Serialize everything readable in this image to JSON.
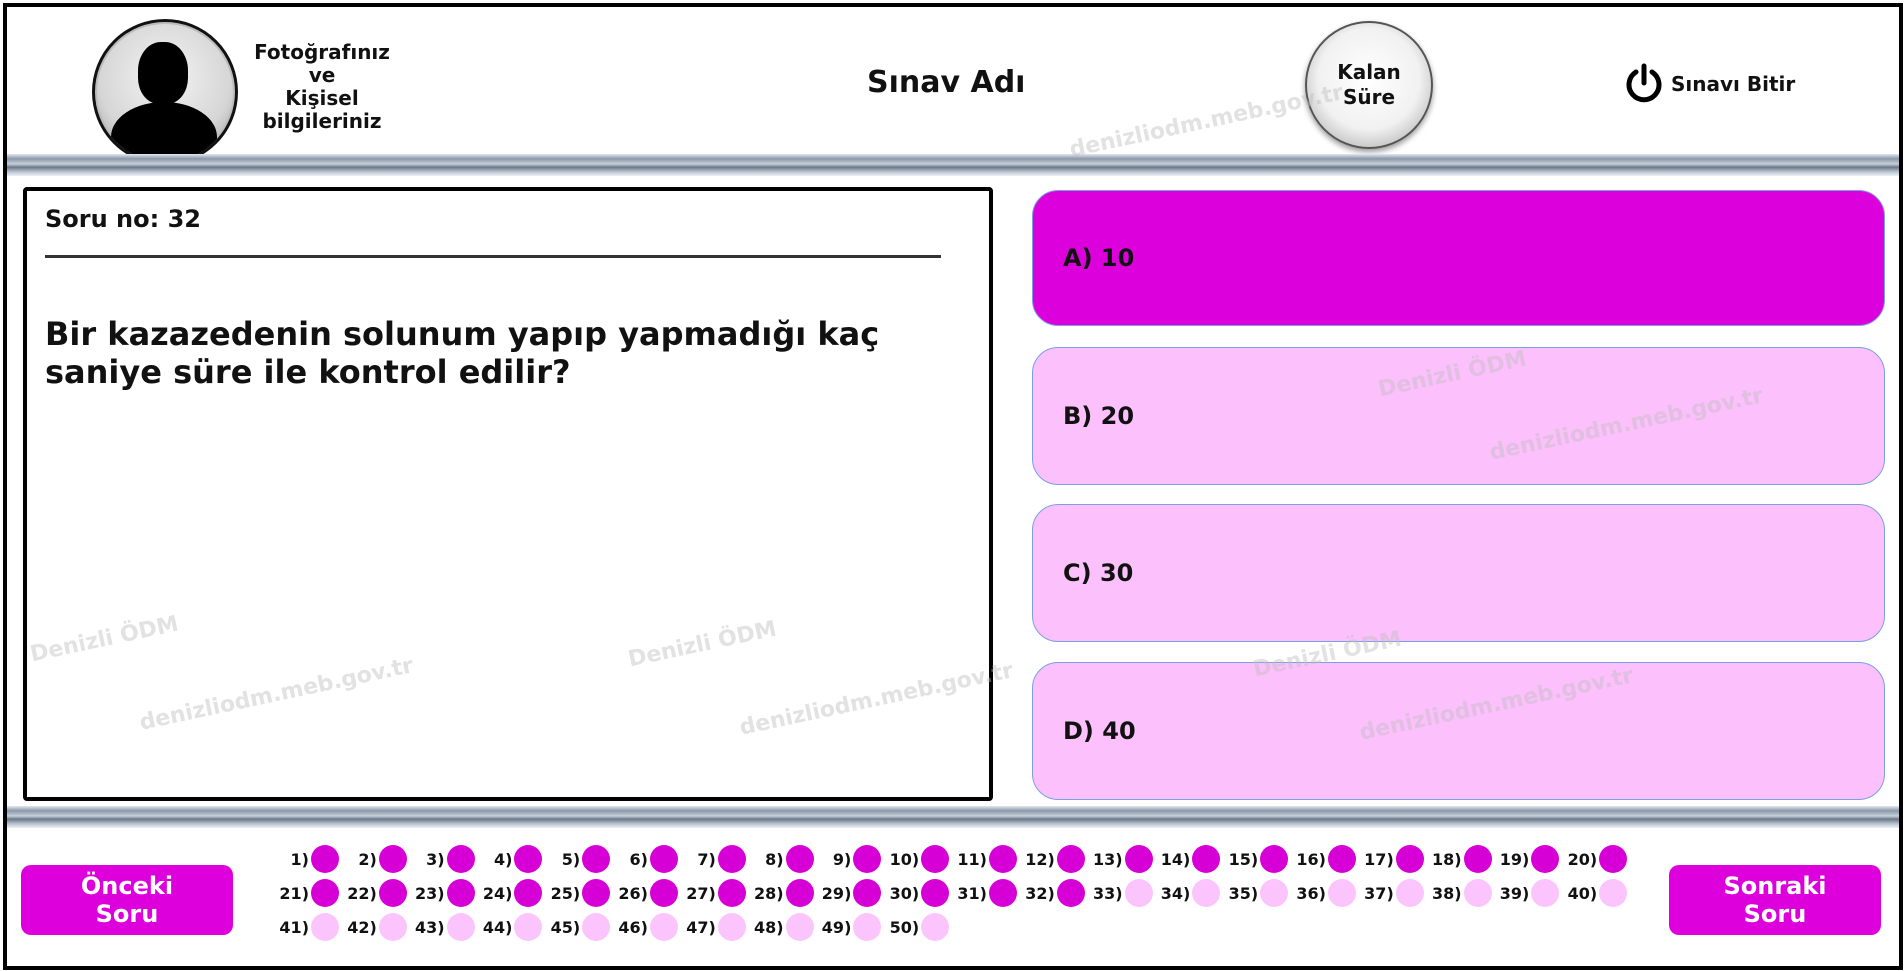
{
  "header": {
    "profile_text_1": "Fotoğrafınız",
    "profile_text_2": "ve",
    "profile_text_3": "Kişisel",
    "profile_text_4": "bilgileriniz",
    "exam_title": "Sınav Adı",
    "timer_line_1": "Kalan",
    "timer_line_2": "Süre",
    "finish_label": "Sınavı Bitir",
    "finish_icon": "power-icon"
  },
  "question": {
    "number_label": "Soru no: 32",
    "text": "Bir kazazedenin solunum yapıp yapmadığı kaç saniye süre ile kontrol edilir?"
  },
  "options": [
    {
      "label": "A) 10",
      "selected": true
    },
    {
      "label": "B) 20",
      "selected": false
    },
    {
      "label": "C) 30",
      "selected": false
    },
    {
      "label": "D) 40",
      "selected": false
    }
  ],
  "nav": {
    "prev_line_1": "Önceki",
    "prev_line_2": "Soru",
    "next_line_1": "Sonraki",
    "next_line_2": "Soru"
  },
  "question_grid": {
    "total": 50,
    "answered_count": 32,
    "labels": [
      "1)",
      "2)",
      "3)",
      "4)",
      "5)",
      "6)",
      "7)",
      "8)",
      "9)",
      "10)",
      "11)",
      "12)",
      "13)",
      "14)",
      "15)",
      "16)",
      "17)",
      "18)",
      "19)",
      "20)",
      "21)",
      "22)",
      "23)",
      "24)",
      "25)",
      "26)",
      "27)",
      "28)",
      "29)",
      "30)",
      "31)",
      "32)",
      "33)",
      "34)",
      "35)",
      "36)",
      "37)",
      "38)",
      "39)",
      "40)",
      "41)",
      "42)",
      "43)",
      "44)",
      "45)",
      "46)",
      "47)",
      "48)",
      "49)",
      "50)"
    ]
  },
  "watermarks": {
    "line_1": "Denizli ÖDM",
    "line_2": "denizliodm.meb.gov.tr"
  },
  "colors": {
    "accent": "#dd00dd",
    "option_selected": "#dc00dc",
    "option_default": "#fcc0fc",
    "dot_answered": "#d600d6",
    "dot_unanswered": "#fcc4fc"
  }
}
